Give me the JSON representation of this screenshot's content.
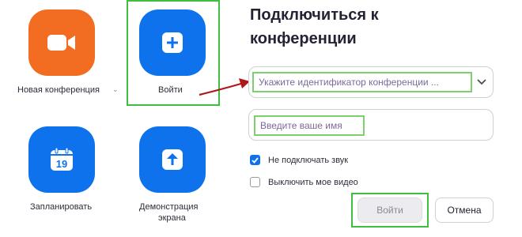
{
  "home": {
    "tiles": [
      {
        "id": "new",
        "label": "Новая конференция",
        "has_caret": true
      },
      {
        "id": "join",
        "label": "Войти"
      },
      {
        "id": "schedule",
        "label": "Запланировать",
        "calendar_day": "19"
      },
      {
        "id": "share",
        "label_line1": "Демонстрация",
        "label_line2": "экрана"
      }
    ]
  },
  "dialog": {
    "title_line1": "Подключиться к",
    "title_line2": "конференции",
    "meeting_id_placeholder": "Укажите идентификатор конференции ...",
    "name_placeholder": "Введите ваше имя",
    "option_no_audio": {
      "label": "Не подключать звук",
      "checked": true
    },
    "option_video_off": {
      "label": "Выключить мое видео",
      "checked": false
    },
    "join_button": "Войти",
    "cancel_button": "Отмена"
  },
  "icons": {
    "new_meeting": "video-camera-icon",
    "join": "plus-icon",
    "schedule": "calendar-icon",
    "share": "share-arrow-up-icon",
    "dropdown": "chevron-down-icon",
    "pointer": "red-arrow-annotation"
  },
  "colors": {
    "orange_tile": "#f26d21",
    "blue_tile": "#0e72ed",
    "highlight_green": "#3fbf3f",
    "annotation_arrow": "#b01818"
  }
}
